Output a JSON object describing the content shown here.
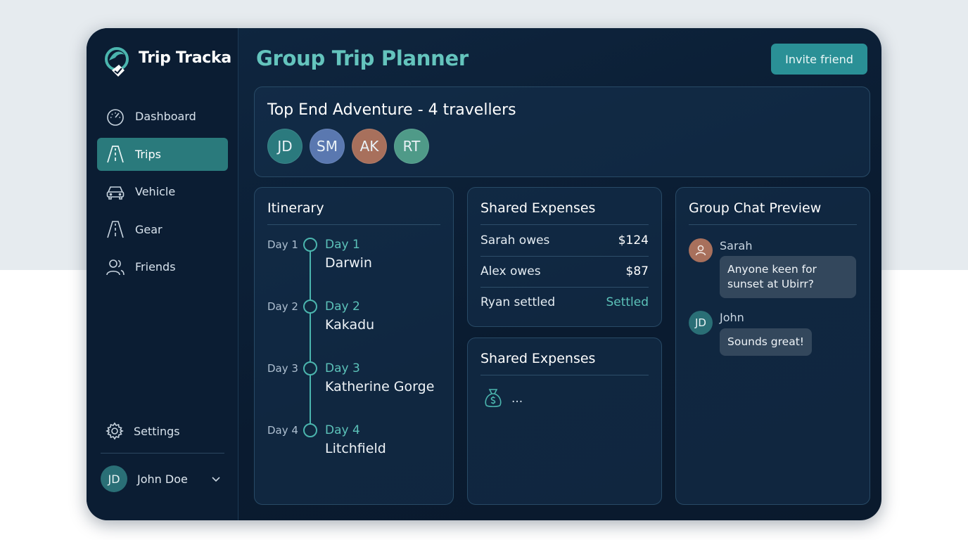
{
  "app": {
    "name": "Trip Tracka",
    "accent": "#2a9096",
    "title_color": "#64c4bd"
  },
  "sidebar": {
    "items": [
      {
        "label": "Dashboard",
        "icon": "gauge-icon",
        "active": false
      },
      {
        "label": "Trips",
        "icon": "road-icon",
        "active": true
      },
      {
        "label": "Vehicle",
        "icon": "car-icon",
        "active": false
      },
      {
        "label": "Gear",
        "icon": "road-icon",
        "active": false
      },
      {
        "label": "Friends",
        "icon": "users-icon",
        "active": false
      }
    ],
    "settings_label": "Settings",
    "user": {
      "initials": "JD",
      "name": "John Doe"
    }
  },
  "header": {
    "title": "Group Trip Planner",
    "invite_label": "Invite friend"
  },
  "trip": {
    "title": "Top End Adventure - 4 travellers",
    "travellers": [
      {
        "initials": "JD",
        "color": "#2b7a7e"
      },
      {
        "initials": "SM",
        "color": "#5a78b0"
      },
      {
        "initials": "AK",
        "color": "#a8705c"
      },
      {
        "initials": "RT",
        "color": "#4f9a88"
      }
    ]
  },
  "itinerary": {
    "title": "Itinerary",
    "days": [
      {
        "label": "Day 1",
        "name": "Day 1",
        "place": "Darwin"
      },
      {
        "label": "Day 2",
        "name": "Day 2",
        "place": "Kakadu"
      },
      {
        "label": "Day 3",
        "name": "Day 3",
        "place": "Katherine Gorge"
      },
      {
        "label": "Day 4",
        "name": "Day 4",
        "place": "Litchfield"
      }
    ]
  },
  "expenses": {
    "title": "Shared Expenses",
    "rows": [
      {
        "label": "Sarah owes",
        "value": "$124",
        "settled": false
      },
      {
        "label": "Alex owes",
        "value": "$87",
        "settled": false
      },
      {
        "label": "Ryan settled",
        "value": "Settled",
        "settled": true
      }
    ]
  },
  "expenses2": {
    "title": "Shared Expenses",
    "placeholder": "..."
  },
  "chat": {
    "title": "Group Chat Preview",
    "messages": [
      {
        "sender": "Sarah",
        "avatar": "person-icon",
        "text": "Anyone keen for sunset at Ubirr?"
      },
      {
        "sender": "John",
        "initials": "JD",
        "text": "Sounds great!"
      }
    ]
  }
}
